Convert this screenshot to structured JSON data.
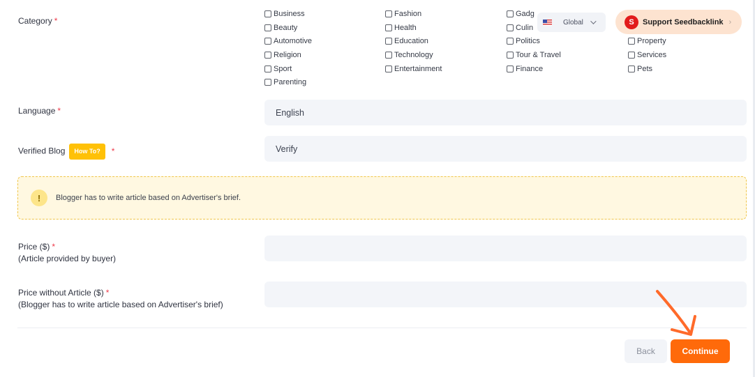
{
  "category": {
    "label": "Category",
    "required_mark": "*",
    "options": [
      "Business",
      "Fashion",
      "Gadg",
      "Beauty",
      "Health",
      "Culin",
      "Automotive",
      "Education",
      "Politics",
      "Property",
      "Religion",
      "Technology",
      "Tour & Travel",
      "Services",
      "Sport",
      "Entertainment",
      "Finance",
      "Pets",
      "Parenting"
    ]
  },
  "region": {
    "label": "Global",
    "flag_icon": "us-flag-icon"
  },
  "support": {
    "logo_letter": "S",
    "label": "Support Seedbacklink",
    "chevron": "›"
  },
  "language": {
    "label": "Language",
    "required_mark": "*",
    "value": "English"
  },
  "verified_blog": {
    "label": "Verified Blog",
    "howto_label": "How To?",
    "required_mark": "*",
    "value": "Verify"
  },
  "notice": {
    "icon": "!",
    "text": "Blogger has to write article based on Advertiser's brief."
  },
  "price": {
    "label": "Price ($)",
    "required_mark": "*",
    "sublabel": "(Article provided by buyer)",
    "value": ""
  },
  "price_without_article": {
    "label": "Price without Article ($)",
    "required_mark": "*",
    "sublabel": "(Blogger has to write article based on Advertiser's brief)",
    "value": ""
  },
  "actions": {
    "back_label": "Back",
    "continue_label": "Continue"
  },
  "colors": {
    "accent": "#ff6a0a",
    "notice_bg": "#fff8e1",
    "howto": "#ffc107",
    "required": "#ee3a4a"
  }
}
